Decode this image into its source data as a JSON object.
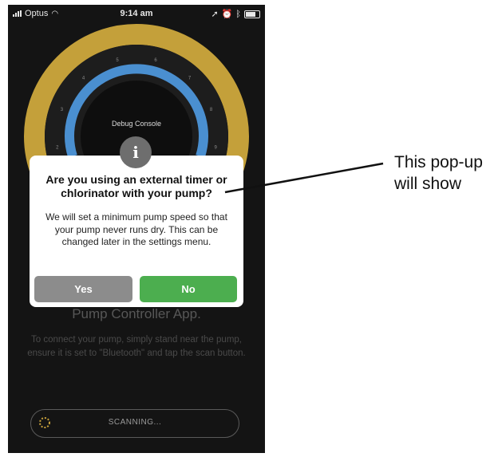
{
  "status_bar": {
    "carrier": "Optus",
    "time": "9:14 am"
  },
  "gauge": {
    "label": "Debug Console",
    "tick_numbers": [
      "1",
      "2",
      "3",
      "4",
      "5",
      "6",
      "7",
      "8",
      "9",
      "10"
    ],
    "colors": {
      "outer_ring": "#c4a03a",
      "inner_arc": "#4a8fd0"
    }
  },
  "background": {
    "title": "Pump Controller App.",
    "instructions": "To connect your pump, simply stand near the pump, ensure it is set to \"Bluetooth\" and tap the scan button.",
    "scan_label": "SCANNING..."
  },
  "dialog": {
    "icon": "info-icon",
    "icon_glyph": "i",
    "title": "Are you using an external timer or chlorinator with your pump?",
    "body": "We will set a minimum pump speed so that your pump never runs dry. This can be changed later in the settings menu.",
    "yes_label": "Yes",
    "no_label": "No",
    "colors": {
      "yes": "#8c8c8c",
      "no": "#4cae4f"
    }
  },
  "annotation": {
    "text_line1": "This pop-up",
    "text_line2": "will show"
  }
}
